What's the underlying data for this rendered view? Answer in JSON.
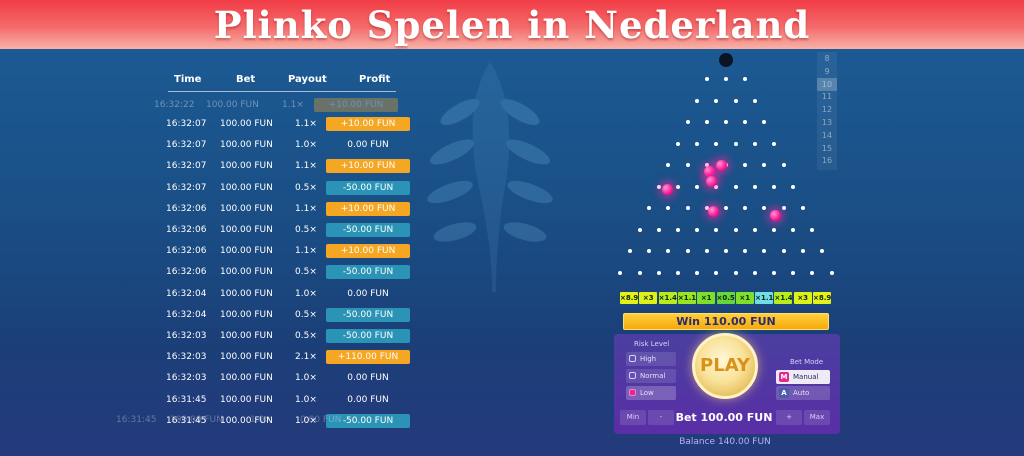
{
  "banner": {
    "title": "Plinko Spelen in Nederland"
  },
  "history": {
    "headers": {
      "time": "Time",
      "bet": "Bet",
      "payout": "Payout",
      "profit": "Profit"
    },
    "faded_row": {
      "time": "16:32:22",
      "bet": "100.00 FUN",
      "payout": "1.1×",
      "profit": "+10.00 FUN"
    },
    "rows": [
      {
        "time": "16:32:07",
        "bet": "100.00 FUN",
        "payout": "1.1×",
        "profit": "+10.00 FUN",
        "kind": "win"
      },
      {
        "time": "16:32:07",
        "bet": "100.00 FUN",
        "payout": "1.0×",
        "profit": "0.00 FUN",
        "kind": "zero"
      },
      {
        "time": "16:32:07",
        "bet": "100.00 FUN",
        "payout": "1.1×",
        "profit": "+10.00 FUN",
        "kind": "win"
      },
      {
        "time": "16:32:07",
        "bet": "100.00 FUN",
        "payout": "0.5×",
        "profit": "-50.00 FUN",
        "kind": "loss"
      },
      {
        "time": "16:32:06",
        "bet": "100.00 FUN",
        "payout": "1.1×",
        "profit": "+10.00 FUN",
        "kind": "win"
      },
      {
        "time": "16:32:06",
        "bet": "100.00 FUN",
        "payout": "0.5×",
        "profit": "-50.00 FUN",
        "kind": "loss"
      },
      {
        "time": "16:32:06",
        "bet": "100.00 FUN",
        "payout": "1.1×",
        "profit": "+10.00 FUN",
        "kind": "win"
      },
      {
        "time": "16:32:06",
        "bet": "100.00 FUN",
        "payout": "0.5×",
        "profit": "-50.00 FUN",
        "kind": "loss"
      },
      {
        "time": "16:32:04",
        "bet": "100.00 FUN",
        "payout": "1.0×",
        "profit": "0.00 FUN",
        "kind": "zero"
      },
      {
        "time": "16:32:04",
        "bet": "100.00 FUN",
        "payout": "0.5×",
        "profit": "-50.00 FUN",
        "kind": "loss"
      },
      {
        "time": "16:32:03",
        "bet": "100.00 FUN",
        "payout": "0.5×",
        "profit": "-50.00 FUN",
        "kind": "loss"
      },
      {
        "time": "16:32:03",
        "bet": "100.00 FUN",
        "payout": "2.1×",
        "profit": "+110.00 FUN",
        "kind": "win"
      },
      {
        "time": "16:32:03",
        "bet": "100.00 FUN",
        "payout": "1.0×",
        "profit": "0.00 FUN",
        "kind": "zero"
      },
      {
        "time": "16:31:45",
        "bet": "100.00 FUN",
        "payout": "1.0×",
        "profit": "0.00 FUN",
        "kind": "zero"
      },
      {
        "time": "16:31:45",
        "bet": "100.00 FUN",
        "payout": "1.0×",
        "profit": "-50.00 FUN",
        "kind": "loss"
      }
    ],
    "ghost_row": {
      "time": "16:31:45",
      "bet": "100.00 FUN",
      "payout": "1.0×",
      "profit": "0.00 FUN"
    }
  },
  "rows_selector": {
    "options": [
      "8",
      "9",
      "10",
      "11",
      "12",
      "13",
      "14",
      "15",
      "16"
    ],
    "selected": "10"
  },
  "multipliers": [
    "×8.9",
    "×3",
    "×1.4",
    "×1.1",
    "×1",
    "×0.5",
    "×1",
    "×1.1",
    "×1.4",
    "×3",
    "×8.9"
  ],
  "multiplier_colors": [
    "#e4f21a",
    "#ddf018",
    "#b8ec1c",
    "#98e622",
    "#7ee02a",
    "#63d838",
    "#7ee02a",
    "#6fdde8",
    "#b8ec1c",
    "#ddf018",
    "#e4f21a"
  ],
  "win_bar": {
    "label": "Win 110.00 FUN"
  },
  "risk": {
    "title": "Risk Level",
    "options": [
      "High",
      "Normal",
      "Low"
    ]
  },
  "play_button": {
    "label": "PLAY"
  },
  "bet_mode": {
    "title": "Bet Mode",
    "options": [
      {
        "key": "M",
        "label": "Manual"
      },
      {
        "key": "A",
        "label": "Auto"
      }
    ]
  },
  "bet": {
    "min_label": "Min",
    "minus_label": "-",
    "plus_label": "+",
    "max_label": "Max",
    "amount": "Bet 100.00 FUN"
  },
  "balance": {
    "label": "Balance 140.00 FUN"
  },
  "colors": {
    "win": "#f5a623",
    "loss": "#2b93b5",
    "pink_ball": "#ff1e9a",
    "bet_manual_key": "#e0298f",
    "bet_auto_key": "#4a5da8"
  }
}
